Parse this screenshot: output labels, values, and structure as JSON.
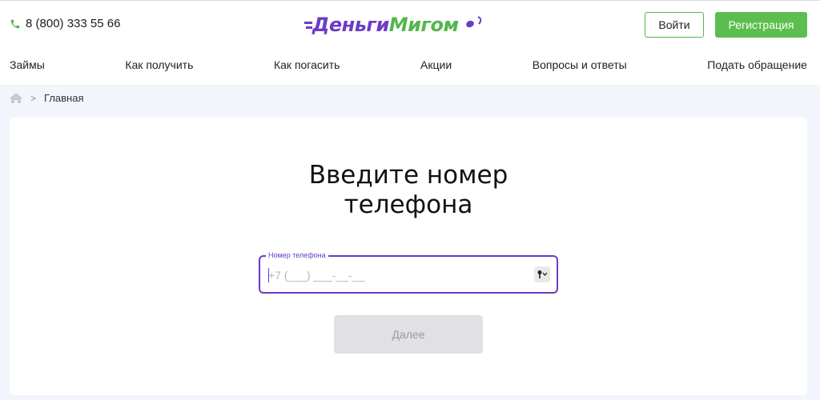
{
  "header": {
    "phone": "8 (800) 333 55 66",
    "logo_part1": "Деньги",
    "logo_part2": "Мигом",
    "login_label": "Войти",
    "register_label": "Регистрация"
  },
  "nav": {
    "items": [
      "Займы",
      "Как получить",
      "Как погасить",
      "Акции",
      "Вопросы и ответы",
      "Подать обращение"
    ]
  },
  "breadcrumb": {
    "separator": ">",
    "current": "Главная"
  },
  "main": {
    "title_line1": "Введите номер",
    "title_line2": "телефона",
    "phone_field": {
      "label": "Номер телефона",
      "placeholder": "+7 (___) ___-__-__",
      "value": ""
    },
    "next_label": "Далее"
  },
  "colors": {
    "brand_purple": "#6c3bc5",
    "brand_green": "#52b84a",
    "register_green": "#5cbe4e",
    "page_bg": "#f2f5fb",
    "disabled_button": "#e1e1e3"
  }
}
